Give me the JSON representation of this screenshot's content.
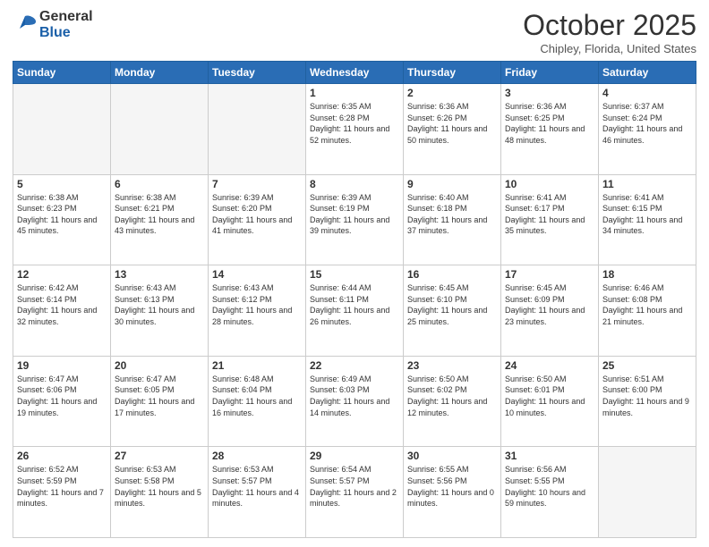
{
  "logo": {
    "general": "General",
    "blue": "Blue"
  },
  "header": {
    "month": "October 2025",
    "location": "Chipley, Florida, United States"
  },
  "weekdays": [
    "Sunday",
    "Monday",
    "Tuesday",
    "Wednesday",
    "Thursday",
    "Friday",
    "Saturday"
  ],
  "weeks": [
    [
      {
        "day": "",
        "empty": true
      },
      {
        "day": "",
        "empty": true
      },
      {
        "day": "",
        "empty": true
      },
      {
        "day": "1",
        "sunrise": "6:35 AM",
        "sunset": "6:28 PM",
        "daylight": "11 hours and 52 minutes."
      },
      {
        "day": "2",
        "sunrise": "6:36 AM",
        "sunset": "6:26 PM",
        "daylight": "11 hours and 50 minutes."
      },
      {
        "day": "3",
        "sunrise": "6:36 AM",
        "sunset": "6:25 PM",
        "daylight": "11 hours and 48 minutes."
      },
      {
        "day": "4",
        "sunrise": "6:37 AM",
        "sunset": "6:24 PM",
        "daylight": "11 hours and 46 minutes."
      }
    ],
    [
      {
        "day": "5",
        "sunrise": "6:38 AM",
        "sunset": "6:23 PM",
        "daylight": "11 hours and 45 minutes."
      },
      {
        "day": "6",
        "sunrise": "6:38 AM",
        "sunset": "6:21 PM",
        "daylight": "11 hours and 43 minutes."
      },
      {
        "day": "7",
        "sunrise": "6:39 AM",
        "sunset": "6:20 PM",
        "daylight": "11 hours and 41 minutes."
      },
      {
        "day": "8",
        "sunrise": "6:39 AM",
        "sunset": "6:19 PM",
        "daylight": "11 hours and 39 minutes."
      },
      {
        "day": "9",
        "sunrise": "6:40 AM",
        "sunset": "6:18 PM",
        "daylight": "11 hours and 37 minutes."
      },
      {
        "day": "10",
        "sunrise": "6:41 AM",
        "sunset": "6:17 PM",
        "daylight": "11 hours and 35 minutes."
      },
      {
        "day": "11",
        "sunrise": "6:41 AM",
        "sunset": "6:15 PM",
        "daylight": "11 hours and 34 minutes."
      }
    ],
    [
      {
        "day": "12",
        "sunrise": "6:42 AM",
        "sunset": "6:14 PM",
        "daylight": "11 hours and 32 minutes."
      },
      {
        "day": "13",
        "sunrise": "6:43 AM",
        "sunset": "6:13 PM",
        "daylight": "11 hours and 30 minutes."
      },
      {
        "day": "14",
        "sunrise": "6:43 AM",
        "sunset": "6:12 PM",
        "daylight": "11 hours and 28 minutes."
      },
      {
        "day": "15",
        "sunrise": "6:44 AM",
        "sunset": "6:11 PM",
        "daylight": "11 hours and 26 minutes."
      },
      {
        "day": "16",
        "sunrise": "6:45 AM",
        "sunset": "6:10 PM",
        "daylight": "11 hours and 25 minutes."
      },
      {
        "day": "17",
        "sunrise": "6:45 AM",
        "sunset": "6:09 PM",
        "daylight": "11 hours and 23 minutes."
      },
      {
        "day": "18",
        "sunrise": "6:46 AM",
        "sunset": "6:08 PM",
        "daylight": "11 hours and 21 minutes."
      }
    ],
    [
      {
        "day": "19",
        "sunrise": "6:47 AM",
        "sunset": "6:06 PM",
        "daylight": "11 hours and 19 minutes."
      },
      {
        "day": "20",
        "sunrise": "6:47 AM",
        "sunset": "6:05 PM",
        "daylight": "11 hours and 17 minutes."
      },
      {
        "day": "21",
        "sunrise": "6:48 AM",
        "sunset": "6:04 PM",
        "daylight": "11 hours and 16 minutes."
      },
      {
        "day": "22",
        "sunrise": "6:49 AM",
        "sunset": "6:03 PM",
        "daylight": "11 hours and 14 minutes."
      },
      {
        "day": "23",
        "sunrise": "6:50 AM",
        "sunset": "6:02 PM",
        "daylight": "11 hours and 12 minutes."
      },
      {
        "day": "24",
        "sunrise": "6:50 AM",
        "sunset": "6:01 PM",
        "daylight": "11 hours and 10 minutes."
      },
      {
        "day": "25",
        "sunrise": "6:51 AM",
        "sunset": "6:00 PM",
        "daylight": "11 hours and 9 minutes."
      }
    ],
    [
      {
        "day": "26",
        "sunrise": "6:52 AM",
        "sunset": "5:59 PM",
        "daylight": "11 hours and 7 minutes."
      },
      {
        "day": "27",
        "sunrise": "6:53 AM",
        "sunset": "5:58 PM",
        "daylight": "11 hours and 5 minutes."
      },
      {
        "day": "28",
        "sunrise": "6:53 AM",
        "sunset": "5:57 PM",
        "daylight": "11 hours and 4 minutes."
      },
      {
        "day": "29",
        "sunrise": "6:54 AM",
        "sunset": "5:57 PM",
        "daylight": "11 hours and 2 minutes."
      },
      {
        "day": "30",
        "sunrise": "6:55 AM",
        "sunset": "5:56 PM",
        "daylight": "11 hours and 0 minutes."
      },
      {
        "day": "31",
        "sunrise": "6:56 AM",
        "sunset": "5:55 PM",
        "daylight": "10 hours and 59 minutes."
      },
      {
        "day": "",
        "empty": true
      }
    ]
  ]
}
